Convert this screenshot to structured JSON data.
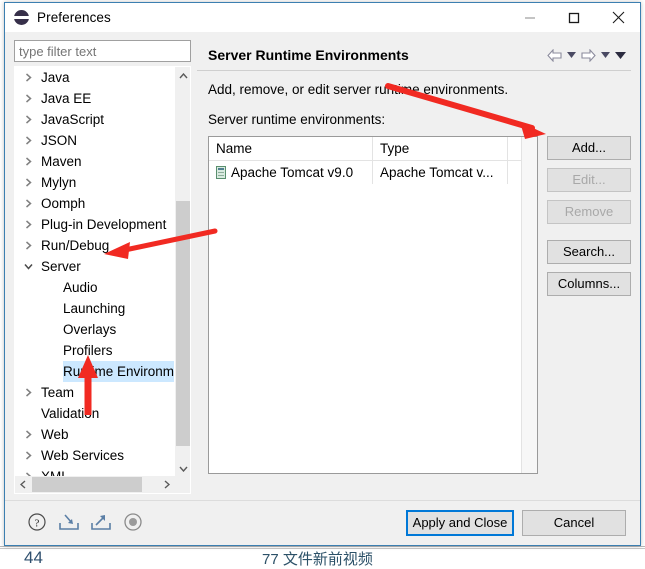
{
  "window": {
    "title": "Preferences",
    "icon": "eclipse-sphere-icon",
    "controls": {
      "minimize": "minimize-icon",
      "maximize": "maximize-icon",
      "close": "close-icon"
    }
  },
  "filter": {
    "placeholder": "type filter text",
    "value": ""
  },
  "tree": {
    "items": [
      {
        "label": "Java",
        "expandable": true,
        "expanded": false,
        "child": false,
        "selected": false
      },
      {
        "label": "Java EE",
        "expandable": true,
        "expanded": false,
        "child": false,
        "selected": false
      },
      {
        "label": "JavaScript",
        "expandable": true,
        "expanded": false,
        "child": false,
        "selected": false
      },
      {
        "label": "JSON",
        "expandable": true,
        "expanded": false,
        "child": false,
        "selected": false
      },
      {
        "label": "Maven",
        "expandable": true,
        "expanded": false,
        "child": false,
        "selected": false
      },
      {
        "label": "Mylyn",
        "expandable": true,
        "expanded": false,
        "child": false,
        "selected": false
      },
      {
        "label": "Oomph",
        "expandable": true,
        "expanded": false,
        "child": false,
        "selected": false
      },
      {
        "label": "Plug-in Development",
        "expandable": true,
        "expanded": false,
        "child": false,
        "selected": false
      },
      {
        "label": "Run/Debug",
        "expandable": true,
        "expanded": false,
        "child": false,
        "selected": false
      },
      {
        "label": "Server",
        "expandable": true,
        "expanded": true,
        "child": false,
        "selected": false
      },
      {
        "label": "Audio",
        "expandable": false,
        "expanded": false,
        "child": true,
        "selected": false
      },
      {
        "label": "Launching",
        "expandable": false,
        "expanded": false,
        "child": true,
        "selected": false
      },
      {
        "label": "Overlays",
        "expandable": false,
        "expanded": false,
        "child": true,
        "selected": false
      },
      {
        "label": "Profilers",
        "expandable": false,
        "expanded": false,
        "child": true,
        "selected": false
      },
      {
        "label": "Runtime Environme",
        "expandable": false,
        "expanded": false,
        "child": true,
        "selected": true
      },
      {
        "label": "Team",
        "expandable": true,
        "expanded": false,
        "child": false,
        "selected": false
      },
      {
        "label": "Validation",
        "expandable": false,
        "expanded": false,
        "child": false,
        "selected": false
      },
      {
        "label": "Web",
        "expandable": true,
        "expanded": false,
        "child": false,
        "selected": false
      },
      {
        "label": "Web Services",
        "expandable": true,
        "expanded": false,
        "child": false,
        "selected": false
      },
      {
        "label": "XML",
        "expandable": true,
        "expanded": false,
        "child": false,
        "selected": false
      }
    ],
    "expanded_glyph": "v",
    "collapsed_glyph": ">"
  },
  "page": {
    "title": "Server Runtime Environments",
    "description": "Add, remove, or edit server runtime environments.",
    "sub_label": "Server runtime environments:",
    "nav": {
      "back": "back-arrow-icon",
      "back_menu": "back-dropdown-icon",
      "forward": "forward-arrow-icon",
      "forward_menu": "forward-dropdown-icon",
      "view_menu": "view-menu-icon"
    }
  },
  "table": {
    "columns": [
      "Name",
      "Type",
      ""
    ],
    "rows": [
      {
        "name": "Apache Tomcat v9.0",
        "type": "Apache Tomcat v...",
        "icon": "server-runtime-icon"
      }
    ]
  },
  "side_buttons": [
    {
      "id": "add",
      "label": "Add...",
      "enabled": true
    },
    {
      "id": "edit",
      "label": "Edit...",
      "enabled": false
    },
    {
      "id": "remove",
      "label": "Remove",
      "enabled": false
    },
    {
      "id": "search",
      "label": "Search...",
      "enabled": true
    },
    {
      "id": "columns",
      "label": "Columns...",
      "enabled": true
    }
  ],
  "footer": {
    "icons": [
      {
        "name": "help-icon"
      },
      {
        "name": "import-icon"
      },
      {
        "name": "export-icon"
      },
      {
        "name": "record-icon"
      }
    ],
    "apply_close_label": "Apply and Close",
    "cancel_label": "Cancel"
  },
  "annotations": {
    "arrow_to_add": "red-arrow-pointing-to-add-button",
    "arrow_to_server": "red-arrow-pointing-to-server-node",
    "arrow_to_runtime": "red-arrow-pointing-to-runtime-environments-node"
  },
  "background": {
    "line1": "44",
    "line2": "77  文件新前视频"
  },
  "colors": {
    "accent": "#0078d7",
    "selection": "#cce8ff",
    "annotation": "#f12a22",
    "dialog_bg": "#f0f0f0",
    "border": "#3c7fb1"
  }
}
